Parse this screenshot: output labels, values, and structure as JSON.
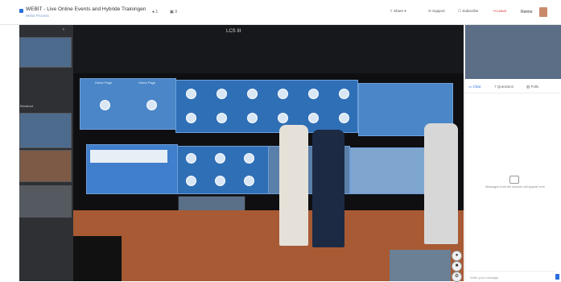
{
  "header": {
    "title": "WEBIT - Live Online Events and Hybride Trainingen",
    "subtitle": "Webit Process",
    "counts": [
      "1",
      "3"
    ],
    "buttons": {
      "share": "Share",
      "support": "Support",
      "subscribe": "Subscribe",
      "leave": "Leave"
    },
    "user_name": "Reimo"
  },
  "left_panel": {
    "section_label": "Breakout"
  },
  "stage": {
    "label": "LCS III",
    "panel_labels": [
      "Home Page",
      "Home Page"
    ]
  },
  "right_panel": {
    "tabs": [
      "Chat",
      "Questions",
      "Polls"
    ],
    "empty_message": "Messages from the session will appear here",
    "input_placeholder": "Write your message"
  },
  "colors": {
    "accent": "#2a6fdb",
    "leave": "#dd3333",
    "stage_bg": "#0f0f12",
    "panel_blue": "#2f6fb6"
  },
  "icons": {
    "app": "app-logo-icon",
    "collapse": "chevron-left-icon",
    "chat_empty": "chat-bubble-icon",
    "send": "send-icon"
  }
}
